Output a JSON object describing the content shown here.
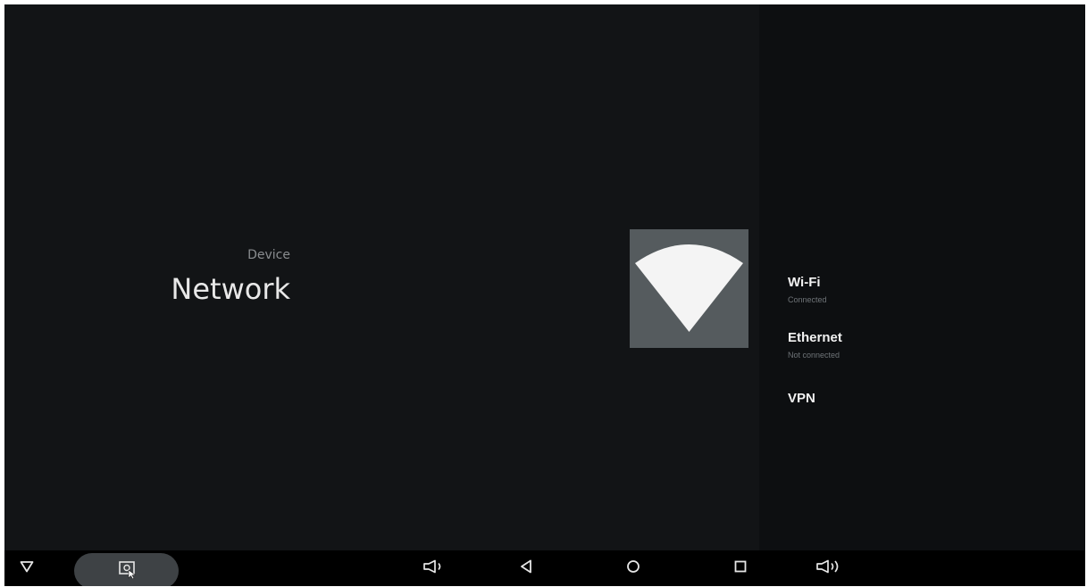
{
  "header": {
    "category": "Device",
    "title": "Network"
  },
  "hero_icon": "wifi-icon",
  "menu": {
    "items": [
      {
        "label": "Wi-Fi",
        "sub": "Connected"
      },
      {
        "label": "Ethernet",
        "sub": "Not connected"
      },
      {
        "label": "VPN",
        "sub": ""
      }
    ]
  },
  "navbar": {
    "buttons": [
      {
        "name": "collapse-icon"
      },
      {
        "name": "screenshot-icon"
      },
      {
        "name": "volume-down-icon"
      },
      {
        "name": "back-icon"
      },
      {
        "name": "home-icon"
      },
      {
        "name": "recents-icon"
      },
      {
        "name": "volume-up-icon"
      }
    ]
  },
  "colors": {
    "background": "#121416",
    "panel": "#0d0f11",
    "hero_tile": "#555b5e",
    "navbar": "#000000",
    "text_primary": "#e8e8e8",
    "text_secondary": "#8a8d90"
  }
}
